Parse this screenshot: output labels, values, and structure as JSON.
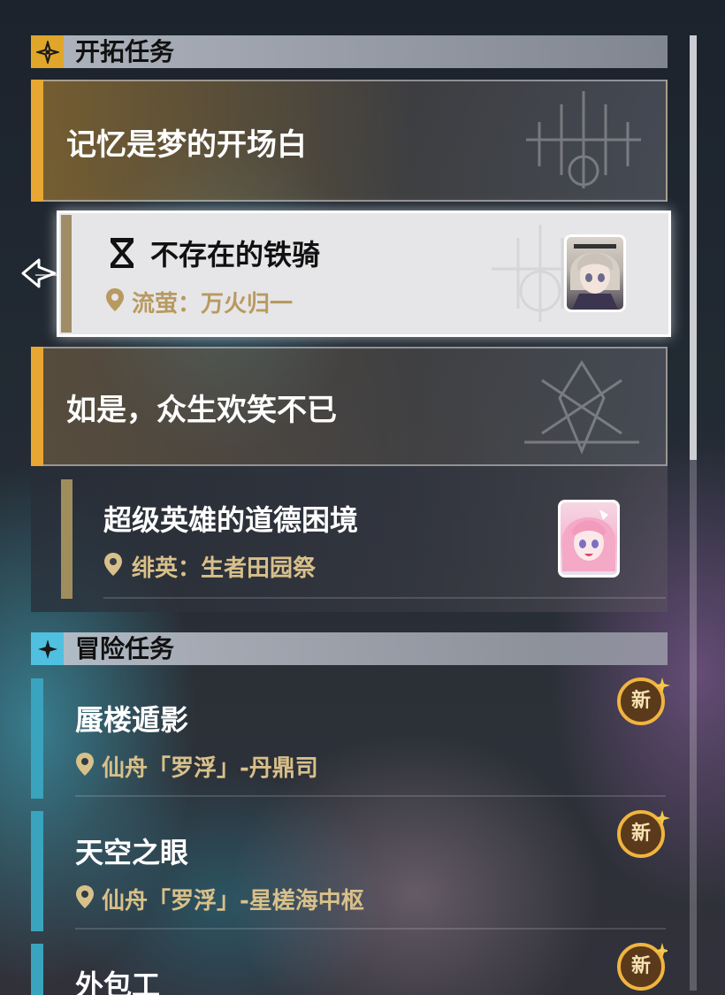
{
  "trailblaze": {
    "header": "开拓任务",
    "icon": "trailblaze-star-icon",
    "groups": [
      {
        "title": "记忆是梦的开场白",
        "missions": [
          {
            "title": "不存在的铁骑",
            "location": "流萤：万火归一",
            "status_icon": "hourglass-icon",
            "avatar": "firefly-avatar",
            "selected": true
          }
        ]
      },
      {
        "title": "如是，众生欢笑不已",
        "missions": [
          {
            "title": "超级英雄的道德困境",
            "location": "绯英：生者田园祭",
            "avatar": "pink-hair-avatar",
            "selected": false
          }
        ]
      }
    ]
  },
  "adventure": {
    "header": "冒险任务",
    "icon": "adventure-star-icon",
    "missions": [
      {
        "title": "蜃楼遁影",
        "location": "仙舟「罗浮」-丹鼎司",
        "badge": "新"
      },
      {
        "title": "天空之眼",
        "location": "仙舟「罗浮」-星槎海中枢",
        "badge": "新"
      },
      {
        "title": "外包工",
        "badge": "新"
      }
    ]
  },
  "colors": {
    "trailblaze_accent": "#e8a732",
    "adventure_accent": "#3aa3bd",
    "mission_bar": "#a08d5c",
    "location_text": "#d8c08a"
  }
}
